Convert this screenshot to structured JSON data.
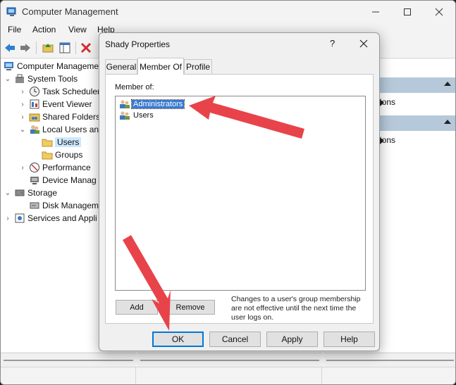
{
  "window": {
    "title": "Computer Management",
    "menu": [
      "File",
      "Action",
      "View",
      "Help"
    ]
  },
  "tree": {
    "items": [
      {
        "label": "Computer Manageme",
        "icon": "computer-icon",
        "expander": ""
      },
      {
        "label": "System Tools",
        "icon": "tools-icon",
        "expander": "⌄"
      },
      {
        "label": "Task Scheduler",
        "icon": "clock-icon",
        "expander": "›"
      },
      {
        "label": "Event Viewer",
        "icon": "event-viewer-icon",
        "expander": "›"
      },
      {
        "label": "Shared Folders",
        "icon": "shared-folder-icon",
        "expander": "›"
      },
      {
        "label": "Local Users an",
        "icon": "users-icon",
        "expander": "⌄"
      },
      {
        "label": "Users",
        "icon": "folder-icon",
        "expander": ""
      },
      {
        "label": "Groups",
        "icon": "folder-icon",
        "expander": ""
      },
      {
        "label": "Performance",
        "icon": "performance-icon",
        "expander": "›"
      },
      {
        "label": "Device Manag",
        "icon": "device-manager-icon",
        "expander": ""
      },
      {
        "label": "Storage",
        "icon": "storage-icon",
        "expander": "⌄"
      },
      {
        "label": "Disk Managem",
        "icon": "disk-icon",
        "expander": ""
      },
      {
        "label": "Services and Appli",
        "icon": "services-icon",
        "expander": "›"
      }
    ]
  },
  "actions_pane": {
    "rows": [
      "ions",
      "ions"
    ]
  },
  "dialog": {
    "title": "Shady Properties",
    "help": "?",
    "tabs": [
      "General",
      "Member Of",
      "Profile"
    ],
    "member_of_label": "Member of:",
    "groups": [
      "Administrators",
      "Users"
    ],
    "add_label": "Add",
    "remove_label": "Remove",
    "note": "Changes to a user's group membership are not effective until the next time the user logs on.",
    "ok_label": "OK",
    "cancel_label": "Cancel",
    "apply_label": "Apply",
    "help_label": "Help"
  },
  "colors": {
    "arrow": "#e8434a",
    "selection": "#3979d0",
    "tree_selection": "#cce8ff",
    "actions_header": "#b6c9da"
  }
}
